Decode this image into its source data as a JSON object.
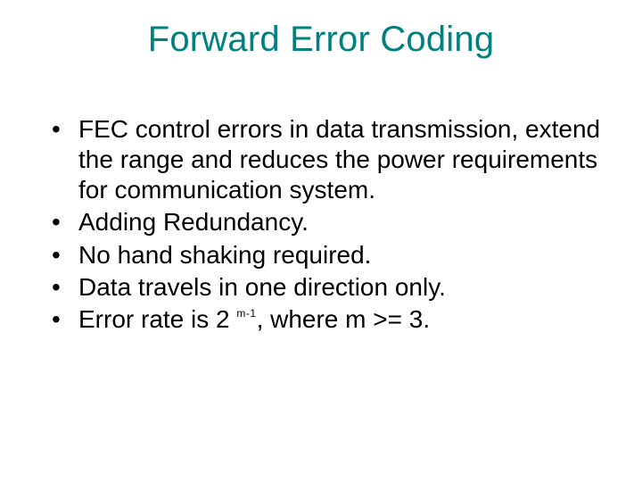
{
  "title": "Forward Error Coding",
  "bullets": [
    "FEC control errors in data transmission, extend the range and reduces the power requirements for communication system.",
    "Adding Redundancy.",
    "No hand shaking required.",
    "Data travels in one direction only."
  ],
  "last_bullet": {
    "prefix": "Error rate is 2 ",
    "exponent": "m-1",
    "suffix": ", where m >= 3."
  }
}
